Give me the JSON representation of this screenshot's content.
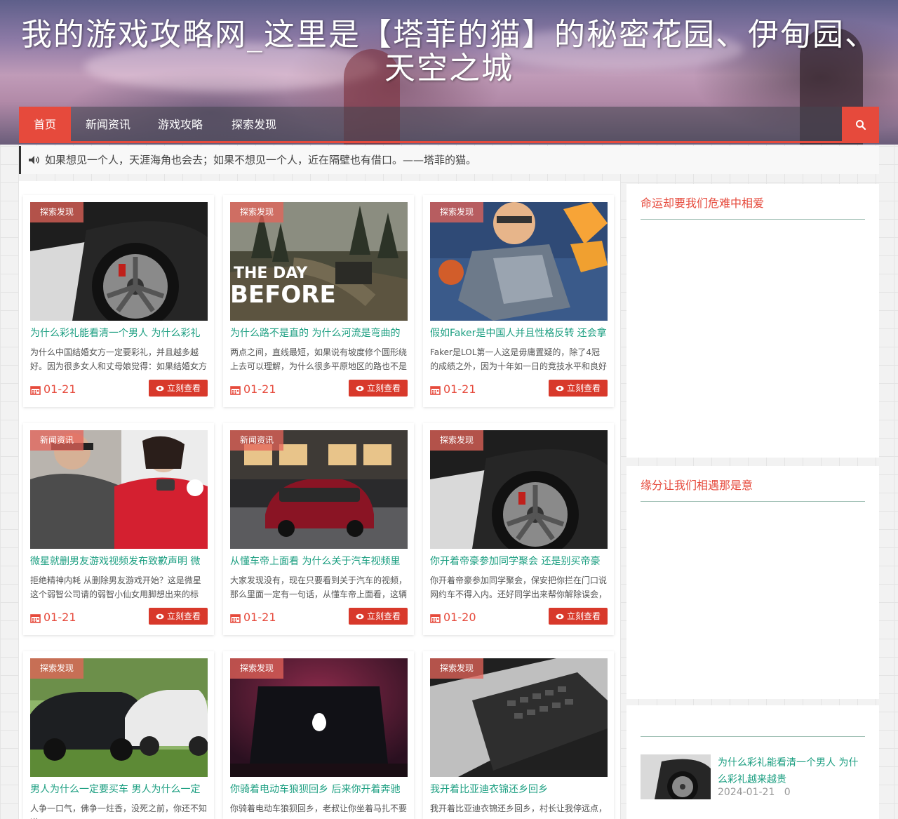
{
  "site": {
    "title": "我的游戏攻略网_这里是【塔菲的猫】的秘密花园、伊甸园、天空之城"
  },
  "nav": {
    "items": [
      {
        "label": "首页",
        "active": true
      },
      {
        "label": "新闻资讯",
        "active": false
      },
      {
        "label": "游戏攻略",
        "active": false
      },
      {
        "label": "探索发现",
        "active": false
      }
    ],
    "search_icon": "search-icon"
  },
  "notice": {
    "icon": "speaker-icon",
    "text": "如果想见一个人，天涯海角也会去；如果不想见一个人，近在隔壁也有借口。——塔菲的猫。"
  },
  "colors": {
    "accent": "#e64a3c",
    "title_green": "#1a9e80",
    "button_red": "#d8392b"
  },
  "cards": [
    {
      "tag": "探索发现",
      "title": "为什么彩礼能看清一个男人 为什么彩礼",
      "excerpt": "为什么中国结婚女方一定要彩礼，并且越多越好。因为很多女人和丈母娘觉得：如果结婚女方",
      "date": "01-21",
      "button": "立刻查看",
      "thumb": "car-wheel"
    },
    {
      "tag": "探索发现",
      "title": "为什么路不是直的 为什么河流是弯曲的",
      "excerpt": "两点之间，直线最短，如果说有坡度修个圆形绕上去可以理解，为什么很多平原地区的路也不是",
      "date": "01-21",
      "button": "立刻查看",
      "thumb": "the-day-before"
    },
    {
      "tag": "探索发现",
      "title": "假如Faker是中国人并且性格反转 还会拿",
      "excerpt": "Faker是LOL第一人这是毋庸置疑的，除了4冠的成绩之外，因为十年如一日的竞技水平和良好人",
      "date": "01-21",
      "button": "立刻查看",
      "thumb": "game-hero"
    },
    {
      "tag": "新闻资讯",
      "title": "微星就删男友游戏视频发布致歉声明 微",
      "excerpt": "拒绝精神内耗 从删除男友游戏开始？这是微星这个弱智公司请的弱智小仙女用脚想出来的标",
      "date": "01-21",
      "button": "立刻查看",
      "thumb": "people"
    },
    {
      "tag": "新闻资讯",
      "title": "从懂车帝上面看 为什么关于汽车视频里",
      "excerpt": "大家发现没有，现在只要看到关于汽车的视频，那么里面一定有一句话，从懂车帝上面看，这辆",
      "date": "01-21",
      "button": "立刻查看",
      "thumb": "red-car"
    },
    {
      "tag": "探索发现",
      "title": "你开着帝豪参加同学聚会 还是别买帝豪",
      "excerpt": "你开着帝豪参加同学聚会，保安把你拦在门口说网约车不得入内。还好同学出来帮你解除误会，",
      "date": "01-20",
      "button": "立刻查看",
      "thumb": "car-wheel"
    },
    {
      "tag": "探索发现",
      "title": "男人为什么一定要买车 男人为什么一定",
      "excerpt": "人争一口气，佛争一炷香，没死之前，你还不知道",
      "date": "",
      "button": "",
      "thumb": "suvs"
    },
    {
      "tag": "探索发现",
      "title": "你骑着电动车狼狈回乡 后来你开着奔驰",
      "excerpt": "你骑着电动车狼狈回乡，老叔让你坐着马扎不要",
      "date": "",
      "button": "",
      "thumb": "laptop-dark"
    },
    {
      "tag": "探索发现",
      "title": "我开着比亚迪衣锦还乡回乡",
      "excerpt": "我开着比亚迪衣锦还乡回乡，村长让我停远点，",
      "date": "",
      "button": "",
      "thumb": "keyboard"
    }
  ],
  "sidebar": {
    "widget1_title": "命运却要我们危难中相爱",
    "widget2_title": "缘分让我们相遇那是意",
    "widget3": {
      "item_title": "为什么彩礼能看清一个男人 为什么彩礼越来越贵",
      "item_date": "2024-01-21",
      "item_count": "0"
    }
  }
}
